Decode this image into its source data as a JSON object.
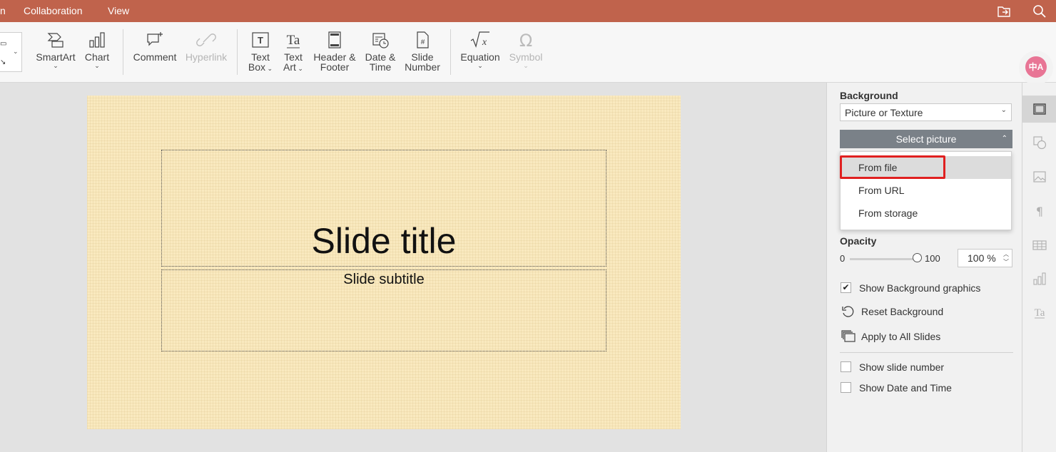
{
  "menu": {
    "tabs": [
      "n",
      "Collaboration",
      "View"
    ]
  },
  "toolbar": {
    "smartart": "SmartArt",
    "chart": "Chart",
    "comment": "Comment",
    "hyperlink": "Hyperlink",
    "textbox_1": "Text",
    "textbox_2": "Box",
    "textart_1": "Text",
    "textart_2": "Art",
    "headerfooter_1": "Header &",
    "headerfooter_2": "Footer",
    "datetime_1": "Date &",
    "datetime_2": "Time",
    "slidenumber_1": "Slide",
    "slidenumber_2": "Number",
    "equation": "Equation",
    "symbol": "Symbol",
    "language_badge": "中A"
  },
  "slide": {
    "title": "Slide title",
    "subtitle": "Slide subtitle"
  },
  "panel": {
    "background_label": "Background",
    "fill_type": "Picture or Texture",
    "select_picture": "Select picture",
    "dropdown_items": [
      "From file",
      "From URL",
      "From storage"
    ],
    "opacity_label": "Opacity",
    "opacity_min": "0",
    "opacity_max": "100",
    "opacity_value": "100 %",
    "opacity_level_percent": 100,
    "show_background_graphics": "Show Background graphics",
    "show_background_graphics_checked": true,
    "reset_background": "Reset Background",
    "apply_all": "Apply to All Slides",
    "show_slide_number": "Show slide number",
    "show_date_time": "Show Date and Time"
  },
  "colors": {
    "topbar": "#c0634c",
    "highlight_box": "#e02020",
    "select_button": "#7a8188"
  }
}
